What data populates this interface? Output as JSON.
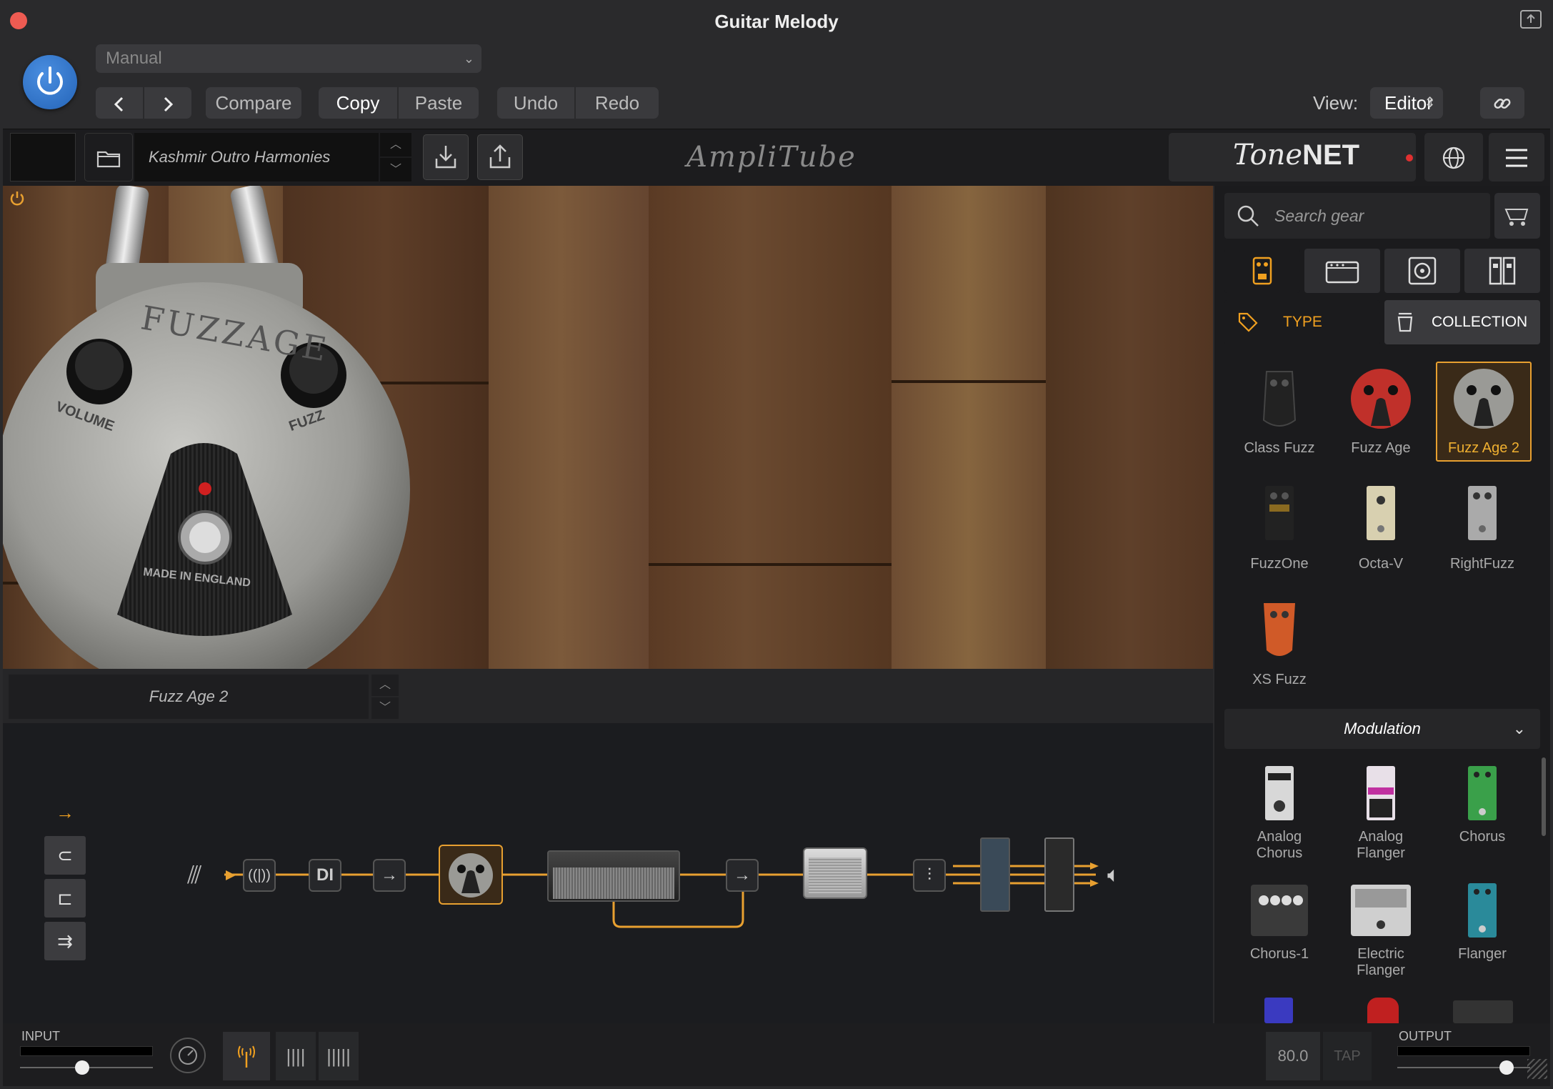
{
  "window": {
    "title": "Guitar Melody"
  },
  "toolbar": {
    "preset_mode": "Manual",
    "compare": "Compare",
    "copy": "Copy",
    "paste": "Paste",
    "undo": "Undo",
    "redo": "Redo",
    "view_label": "View:",
    "view_value": "Editor"
  },
  "amplitube": {
    "preset_name": "Kashmir Outro Harmonies",
    "logo": "AmpliTube",
    "tonenet_logo_script": "Tone",
    "tonenet_logo_bold": "NET"
  },
  "stage": {
    "pedal": {
      "name": "FUZZAGE",
      "knob_left": "VOLUME",
      "knob_right": "FUZZ",
      "footer": "MADE IN ENGLAND"
    }
  },
  "selected_block": {
    "name": "Fuzz Age 2"
  },
  "chain": {
    "nodes": [
      "DI"
    ]
  },
  "browser": {
    "search_placeholder": "Search gear",
    "filter_type": "TYPE",
    "filter_collection": "COLLECTION",
    "fuzz_items": [
      {
        "label": "Class Fuzz",
        "selected": false
      },
      {
        "label": "Fuzz Age",
        "selected": false
      },
      {
        "label": "Fuzz Age 2",
        "selected": true
      },
      {
        "label": "FuzzOne",
        "selected": false
      },
      {
        "label": "Octa-V",
        "selected": false
      },
      {
        "label": "RightFuzz",
        "selected": false
      },
      {
        "label": "XS Fuzz",
        "selected": false
      }
    ],
    "section": "Modulation",
    "modulation_items": [
      {
        "label1": "Analog",
        "label2": "Chorus"
      },
      {
        "label1": "Analog",
        "label2": "Flanger"
      },
      {
        "label1": "Chorus",
        "label2": ""
      },
      {
        "label1": "Chorus-1",
        "label2": ""
      },
      {
        "label1": "Electric",
        "label2": "Flanger"
      },
      {
        "label1": "Flanger",
        "label2": ""
      }
    ]
  },
  "footer": {
    "input_label": "INPUT",
    "output_label": "OUTPUT",
    "bpm": "80.0",
    "tap": "TAP",
    "input_level": 0.47,
    "output_level": 0.82
  },
  "colors": {
    "accent": "#f0a020",
    "power_blue": "#2f74c8",
    "selected_gold": "#e8a030"
  },
  "icons": [
    "power-icon",
    "chevron-left-icon",
    "chevron-right-icon",
    "link-icon",
    "folder-icon",
    "download-icon",
    "share-icon",
    "globe-icon",
    "menu-icon",
    "search-icon",
    "pedal-category-icon",
    "amp-category-icon",
    "cab-category-icon",
    "rack-category-icon",
    "tag-icon",
    "collection-icon",
    "speaker-icon",
    "tuner-icon",
    "metronome-icon"
  ]
}
